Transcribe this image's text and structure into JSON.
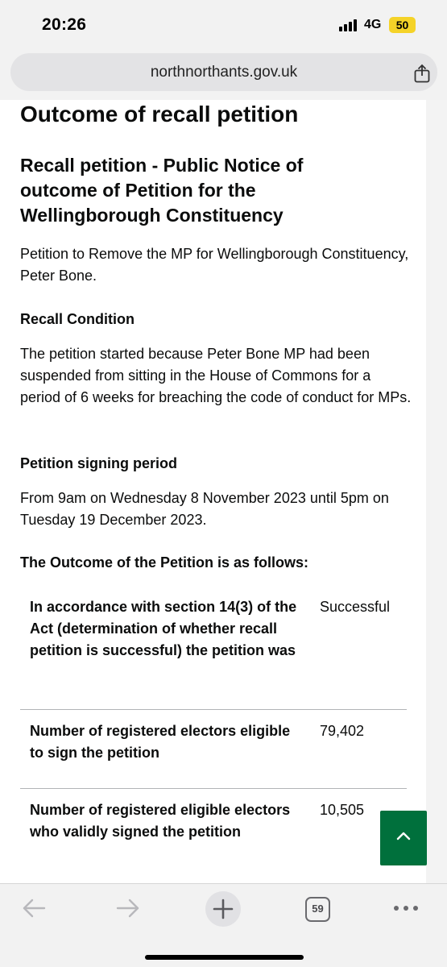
{
  "status_bar": {
    "time": "20:26",
    "network": "4G",
    "battery": "50",
    "battery_color": "#f5d328"
  },
  "browser": {
    "url": "northnorthants.gov.uk",
    "share_icon": "share-icon",
    "tab_count": "59",
    "toolbar_icons": [
      "back-arrow-icon",
      "forward-arrow-icon",
      "new-tab-plus-icon",
      "tabs-icon",
      "more-icon"
    ]
  },
  "page": {
    "title": "Outcome of recall petition",
    "notice_heading": "Recall petition - Public Notice of outcome of Petition for the Wellingborough Constituency",
    "intro": "Petition to Remove the MP for Wellingborough Constituency, Peter Bone.",
    "recall_condition": {
      "heading": "Recall Condition",
      "text": "The petition started because Peter Bone MP had been suspended from sitting in the House of Commons for a period of 6 weeks for breaching the code of conduct for MPs."
    },
    "signing_period": {
      "heading": "Petition signing period",
      "text": "From 9am on Wednesday 8 November 2023 until 5pm on Tuesday 19 December 2023."
    },
    "outcome": {
      "heading": "The Outcome of the Petition is as follows:",
      "rows": [
        {
          "label": "In accordance with section 14(3) of the Act (determination of whether recall petition is successful) the petition was",
          "value": "Successful"
        },
        {
          "label": "Number of registered electors eligible to sign the petition",
          "value": "79,402"
        },
        {
          "label": "Number of registered eligible electors who validly signed the petition",
          "value": "10,505"
        }
      ]
    },
    "back_to_top_color": "#00703c"
  }
}
